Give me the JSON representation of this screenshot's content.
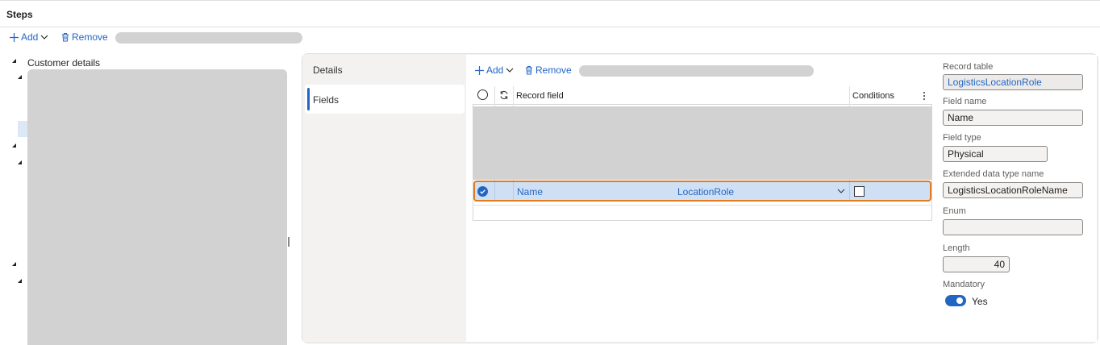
{
  "header": {
    "title": "Steps"
  },
  "steps_toolbar": {
    "add_label": "Add",
    "remove_label": "Remove"
  },
  "tree": {
    "root_label": "Customer details"
  },
  "tabs": [
    {
      "label": "Details"
    },
    {
      "label": "Fields"
    }
  ],
  "fields_toolbar": {
    "add_label": "Add",
    "remove_label": "Remove"
  },
  "grid": {
    "columns": {
      "record_field": "Record field",
      "conditions": "Conditions"
    },
    "selected_row": {
      "field": "Name",
      "value": "LocationRole"
    }
  },
  "properties": {
    "record_table": {
      "label": "Record table",
      "value": "LogisticsLocationRole"
    },
    "field_name": {
      "label": "Field name",
      "value": "Name"
    },
    "field_type": {
      "label": "Field type",
      "value": "Physical"
    },
    "edt_name": {
      "label": "Extended data type name",
      "value": "LogisticsLocationRoleName"
    },
    "enum": {
      "label": "Enum",
      "value": ""
    },
    "length": {
      "label": "Length",
      "value": "40"
    },
    "mandatory": {
      "label": "Mandatory",
      "value": "Yes"
    }
  },
  "colors": {
    "accent": "#2266c4",
    "selection_outline": "#e07b1f",
    "row_selected": "#cfe0f5"
  }
}
